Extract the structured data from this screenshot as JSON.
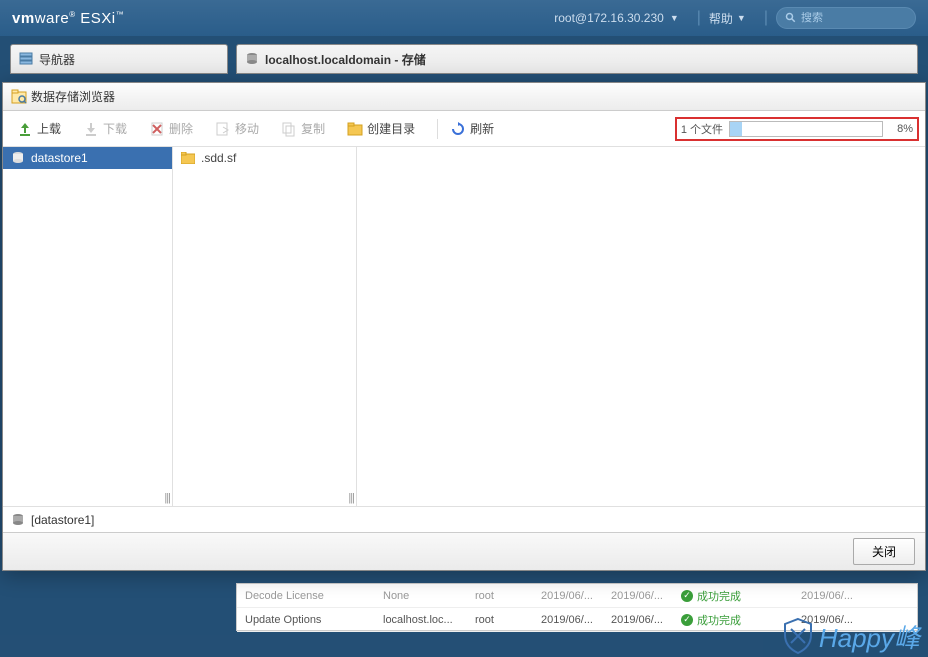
{
  "header": {
    "brand_prefix": "vm",
    "brand_main": "ware",
    "brand_product": " ESXi",
    "user": "root@172.16.30.230",
    "help": "帮助",
    "search_placeholder": "搜索"
  },
  "nav_panel": {
    "title": "导航器"
  },
  "content_panel": {
    "title": "localhost.localdomain - 存储"
  },
  "modal": {
    "title": "数据存储浏览器",
    "toolbar": {
      "upload": "上载",
      "download": "下载",
      "delete": "删除",
      "move": "移动",
      "copy": "复制",
      "mkdir": "创建目录",
      "refresh": "刷新"
    },
    "progress": {
      "label": "1 个文件",
      "percent_value": 8,
      "percent_text": "8%"
    },
    "datastores": [
      {
        "name": "datastore1",
        "selected": true
      }
    ],
    "files": [
      {
        "name": ".sdd.sf",
        "type": "folder"
      }
    ],
    "breadcrumb": "[datastore1]",
    "close": "关闭"
  },
  "bg_table": {
    "rows": [
      {
        "task": "Decode License",
        "target": "None",
        "user": "root",
        "start": "2019/06/...",
        "end": "2019/06/...",
        "status": "成功完成",
        "date": "2019/06/..."
      },
      {
        "task": "Update Options",
        "target": "localhost.loc...",
        "user": "root",
        "start": "2019/06/...",
        "end": "2019/06/...",
        "status": "成功完成",
        "date": "2019/06/..."
      }
    ]
  },
  "watermark": "Happy峰"
}
